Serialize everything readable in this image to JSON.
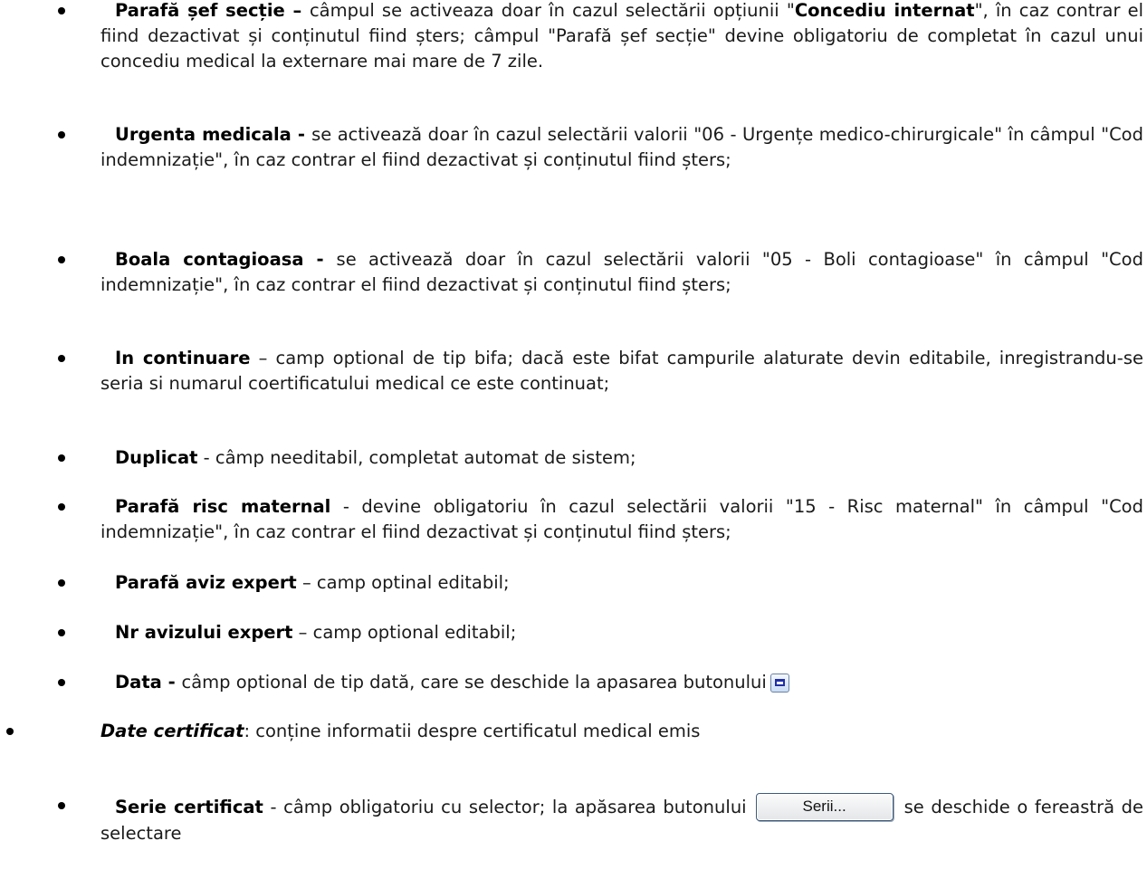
{
  "items": [
    {
      "term": "Parafă șef secție – ",
      "pre": "câmpul se activeaza doar în cazul selectării opțiunii \"",
      "em": "Concediu internat",
      "post": "\", în caz contrar el fiind dezactivat și conținutul fiind șters; câmpul \"Parafă șef secție\" devine obligatoriu de completat în cazul unui concediu medical la externare mai mare de 7 zile."
    },
    {
      "term": "Urgenta medicala - ",
      "text": "se activează doar în cazul selectării valorii \"06 - Urgențe medico-chirurgicale\" în câmpul \"Cod indemnizație\", în caz contrar el fiind dezactivat și conținutul fiind șters;"
    },
    {
      "term": "Boala contagioasa - ",
      "text": "se activează doar în cazul selectării valorii \"05 - Boli contagioase\" în câmpul \"Cod indemnizație\", în caz contrar el fiind dezactivat și conținutul fiind șters;"
    },
    {
      "term": "In continuare",
      "text": " – camp optional de tip bifa; dacă este bifat campurile alaturate devin editabile, inregistrandu-se seria si numarul coertificatului medical ce este continuat;"
    },
    {
      "term": "Duplicat",
      "text": " - câmp needitabil, completat automat de sistem;"
    },
    {
      "term": "Parafă risc maternal",
      "text": " - devine obligatoriu în cazul selectării valorii \"15 - Risc maternal\" în câmpul \"Cod indemnizație\", în caz contrar el fiind dezactivat și conținutul fiind șters;"
    },
    {
      "term": "Parafă aviz expert",
      "text": " – camp optinal editabil;"
    },
    {
      "term": "Nr avizului expert",
      "text": " – camp optional editabil;"
    },
    {
      "term": "Data - ",
      "text": "câmp optional de tip dată, care se deschide la apasarea butonului"
    }
  ],
  "section": {
    "term": "Date certificat",
    "text": ": conține informatii despre certificatul medical emis"
  },
  "serie": {
    "term": "Serie certificat",
    "pre": " - câmp obligatoriu cu selector; la apăsarea butonului",
    "button": "Serii...",
    "post": "se deschide o fereastră de selectare"
  },
  "icons": {
    "calendar_button": "calendar-icon"
  }
}
